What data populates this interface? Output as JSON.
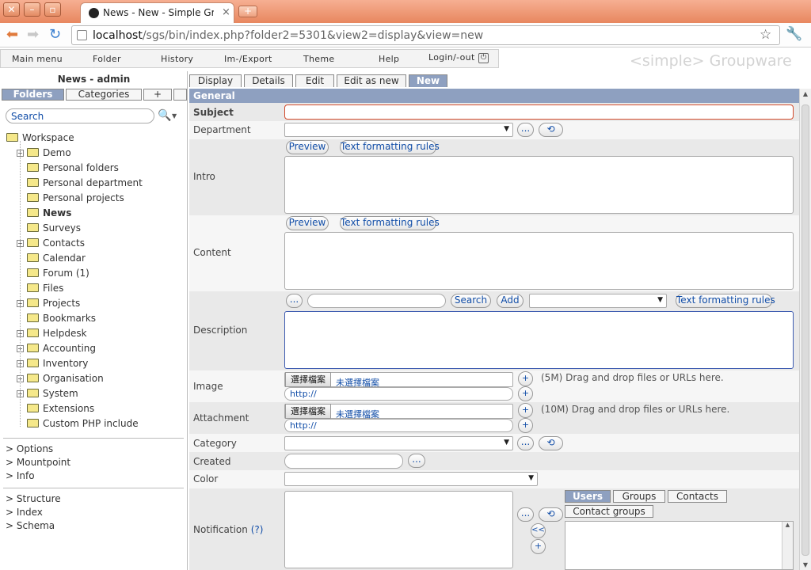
{
  "browser": {
    "tab_title": "News - New - Simple Gr…",
    "tab_close": "×",
    "new_tab": "+",
    "url_host": "localhost",
    "url_rest": "/sgs/bin/index.php?folder2=5301&view2=display&view=new"
  },
  "menu": {
    "items": [
      "Main menu",
      "Folder",
      "History",
      "Im-/Export",
      "Theme",
      "Help",
      "Login/-out"
    ],
    "brand": "<simple> Groupware"
  },
  "sidebar": {
    "title": "News - admin",
    "tabs": [
      "Folders",
      "Categories",
      "+"
    ],
    "search_placeholder": "Search",
    "root": "Workspace",
    "tree": [
      {
        "label": "Demo",
        "expandable": true
      },
      {
        "label": "Personal folders",
        "expandable": false
      },
      {
        "label": "Personal department",
        "expandable": false
      },
      {
        "label": "Personal projects",
        "expandable": false
      },
      {
        "label": "News",
        "expandable": false,
        "selected": true
      },
      {
        "label": "Surveys",
        "expandable": false
      },
      {
        "label": "Contacts",
        "expandable": true
      },
      {
        "label": "Calendar",
        "expandable": false
      },
      {
        "label": "Forum (1)",
        "expandable": false
      },
      {
        "label": "Files",
        "expandable": false
      },
      {
        "label": "Projects",
        "expandable": true
      },
      {
        "label": "Bookmarks",
        "expandable": false
      },
      {
        "label": "Helpdesk",
        "expandable": true
      },
      {
        "label": "Accounting",
        "expandable": true
      },
      {
        "label": "Inventory",
        "expandable": true
      },
      {
        "label": "Organisation",
        "expandable": true
      },
      {
        "label": "System",
        "expandable": true
      },
      {
        "label": "Extensions",
        "expandable": false
      },
      {
        "label": "Custom PHP include",
        "expandable": false
      }
    ],
    "links1": [
      "> Options",
      "> Mountpoint",
      "> Info"
    ],
    "links2": [
      "> Structure",
      "> Index",
      "> Schema"
    ]
  },
  "view_tabs": [
    "Display",
    "Details",
    "Edit",
    "Edit as new",
    "New"
  ],
  "form": {
    "section": "General",
    "subject": "Subject",
    "department": "Department",
    "intro": "Intro",
    "content": "Content",
    "description": "Description",
    "image": "Image",
    "attachment": "Attachment",
    "category": "Category",
    "created": "Created",
    "color": "Color",
    "notification": "Notification",
    "notification_help": "(?)",
    "preview": "Preview",
    "format_rules": "Text formatting rules",
    "search": "Search",
    "add": "Add",
    "more": "...",
    "choose_file": "選擇檔案",
    "no_file": "未選擇檔案",
    "url_value": "http://",
    "image_hint": "(5M)  Drag and drop files or URLs here.",
    "attach_hint": "(10M)  Drag and drop files or URLs here.",
    "plus": "+",
    "back": "<<",
    "notif_tabs": [
      "Users",
      "Groups",
      "Contacts"
    ],
    "contact_groups": "Contact groups"
  },
  "colors": {
    "titlebar": "#e8875f",
    "section_header": "#8ea0c0",
    "link": "#124ea8",
    "active_tab": "#8ea0c0"
  }
}
